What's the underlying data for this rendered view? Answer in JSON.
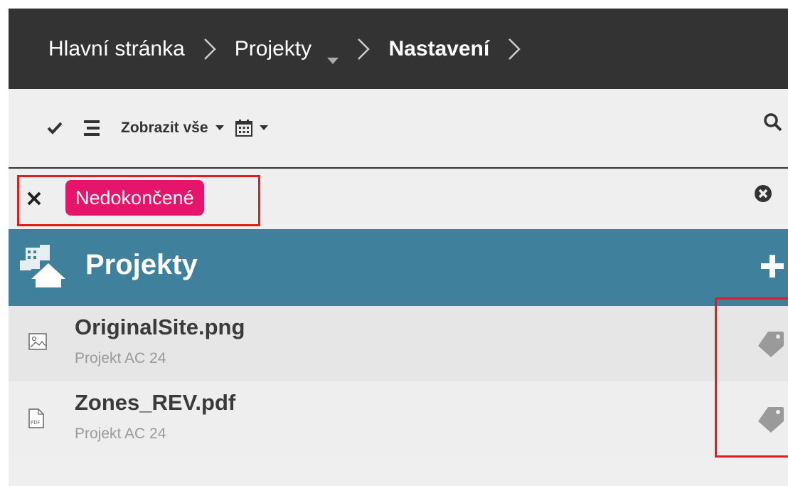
{
  "breadcrumb": {
    "items": [
      {
        "label": "Hlavní stránka"
      },
      {
        "label": "Projekty"
      },
      {
        "label": "Nastavení"
      }
    ]
  },
  "toolbar": {
    "check_icon": "checkmark-icon",
    "list_icon": "list-icon",
    "filter_label": "Zobrazit vše",
    "calendar_icon": "calendar-icon",
    "search_icon": "search-icon"
  },
  "filter": {
    "active_tag": "Nedokončené",
    "tag_color": "#e5156b",
    "highlight_color": "#e31c1c"
  },
  "section": {
    "title": "Projekty",
    "icon": "projects-icon",
    "add_icon": "plus-icon",
    "color": "#3f809d"
  },
  "files": [
    {
      "name": "OriginalSite.png",
      "project": "Projekt AC 24",
      "icon": "image-file-icon"
    },
    {
      "name": "Zones_REV.pdf",
      "project": "Projekt AC 24",
      "icon": "pdf-file-icon"
    }
  ],
  "colors": {
    "header_bg": "#333333",
    "toolbar_bg": "#efefef",
    "tag_icon": "#9a9a9a"
  }
}
